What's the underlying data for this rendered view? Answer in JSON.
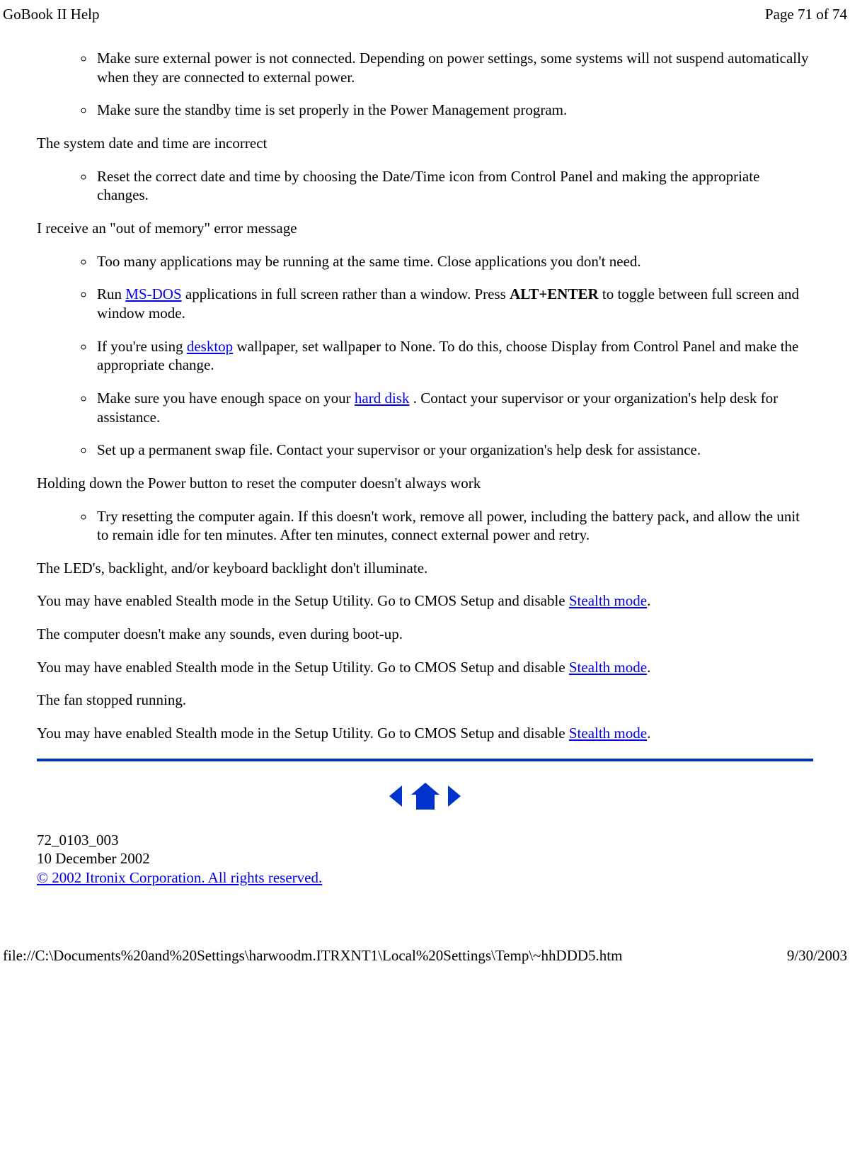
{
  "header": {
    "left": "GoBook II Help",
    "right": "Page 71 of 74"
  },
  "items1_0": "Make sure external power is not connected. Depending on power settings, some systems will not suspend automatically when they are connected to external power.",
  "items1_1": "Make sure the standby time is set properly in the Power Management program.",
  "p1": "The system date and time are incorrect",
  "items2_0": "Reset the correct date and time by choosing the Date/Time icon from Control Panel and making the appropriate changes.",
  "p2": "I receive an \"out of memory\" error message",
  "items3_0": "Too many applications may be running at the same time. Close applications you don't need.",
  "items3_1_a": "Run ",
  "items3_1_link": "MS-DOS",
  "items3_1_b": " applications in full screen rather than a window. Press ",
  "items3_1_bold": "ALT+ENTER",
  "items3_1_c": " to toggle between full screen and window mode.",
  "items3_2_a": "If you're using ",
  "items3_2_link": "desktop",
  "items3_2_b": " wallpaper, set wallpaper to None. To do this, choose Display from Control Panel and make the appropriate change.",
  "items3_3_a": "Make sure you have enough space on your ",
  "items3_3_link": "hard disk",
  "items3_3_b": " . Contact your supervisor or your organization's help desk for assistance.",
  "items3_4": "Set up a permanent swap file. Contact your supervisor or your organization's help desk for assistance.",
  "p3": "Holding down the Power button to reset the computer doesn't always work",
  "items4_0": "Try resetting the computer again. If this doesn't work, remove all power, including the battery pack, and allow the unit to remain idle for ten minutes. After ten minutes, connect external power and retry.",
  "p4": "The LED's, backlight, and/or keyboard backlight don't illuminate.",
  "p5_a": "You may have enabled Stealth mode in the Setup Utility.  Go to CMOS Setup and disable ",
  "p5_link": "Stealth mode",
  "p5_b": ".",
  "p6": "The computer doesn't make any sounds, even during boot-up.",
  "p7_a": "You may have enabled  Stealth mode in the Setup Utility.  Go to CMOS Setup and disable ",
  "p7_link": "Stealth mode",
  "p7_b": ".",
  "p8": "The fan stopped running.",
  "p9_a": "You may have enabled Stealth mode in the Setup Utility.  Go to CMOS Setup and disable ",
  "p9_link": "Stealth mode",
  "p9_b": ".",
  "doc_id": "72_0103_003",
  "doc_date": "10 December 2002",
  "copyright": "© 2002 Itronix Corporation.  All rights reserved.",
  "bottom": {
    "left": "file://C:\\Documents%20and%20Settings\\harwoodm.ITRXNT1\\Local%20Settings\\Temp\\~hhDDD5.htm",
    "right": "9/30/2003"
  }
}
